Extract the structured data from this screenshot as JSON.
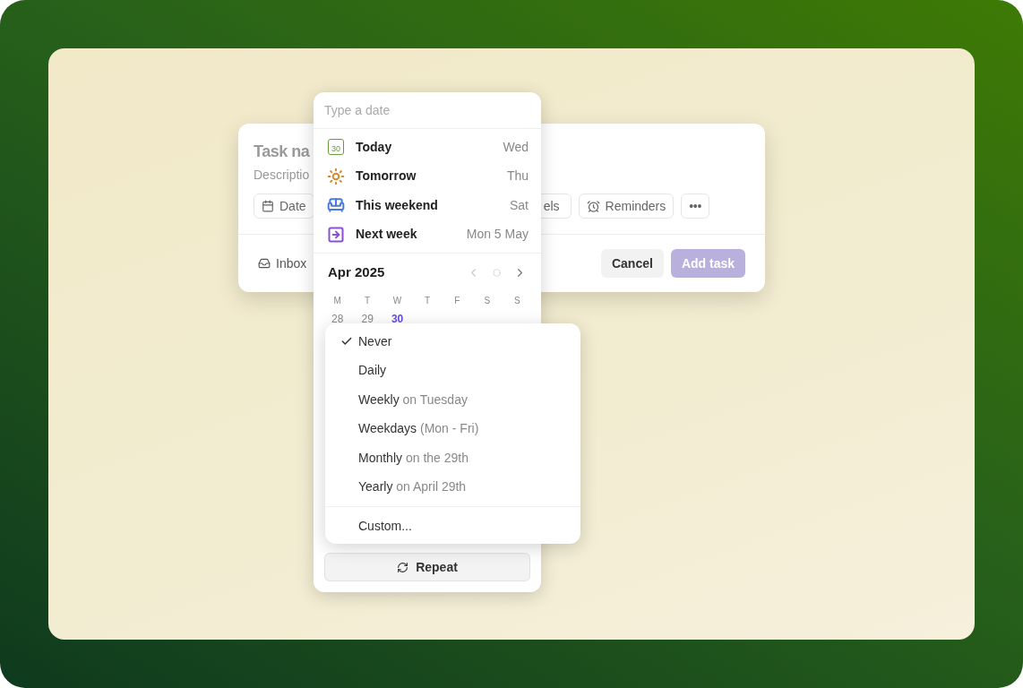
{
  "task_card": {
    "title": "Task na",
    "description": "Descriptio",
    "chips": [
      {
        "kind": "date",
        "label": "Date"
      },
      {
        "kind": "labels",
        "label": "els"
      },
      {
        "kind": "reminders",
        "label": "Reminders"
      },
      {
        "kind": "more",
        "label": "•••"
      }
    ],
    "project": "Inbox",
    "buttons": [
      {
        "kind": "cancel",
        "label": "Cancel",
        "disabled": false
      },
      {
        "kind": "submit",
        "label": "Add task",
        "disabled": true
      }
    ]
  },
  "date_picker": {
    "placeholder": "Type a date",
    "suggestions": [
      {
        "kind": "today",
        "label": "Today",
        "day": "Wed",
        "color": "#6a9a3c",
        "badge": "30"
      },
      {
        "kind": "tomorrow",
        "label": "Tomorrow",
        "day": "Thu",
        "color": "#d68a2a"
      },
      {
        "kind": "weekend",
        "label": "This weekend",
        "day": "Sat",
        "color": "#4a7bd9"
      },
      {
        "kind": "next_week",
        "label": "Next week",
        "day": "Mon 5 May",
        "color": "#8a4fd6"
      }
    ],
    "month": "Apr 2025",
    "weekdays": [
      "M",
      "T",
      "W",
      "T",
      "F",
      "S",
      "S"
    ],
    "days": [
      {
        "label": "28",
        "selected": false
      },
      {
        "label": "29",
        "selected": false
      },
      {
        "label": "30",
        "selected": true
      }
    ],
    "repeat_button": "Repeat"
  },
  "repeat_menu": {
    "options": [
      {
        "label": "Never",
        "selected": true
      },
      {
        "label": "Daily",
        "selected": false
      },
      {
        "label": "Weekly",
        "detail": "on Tuesday",
        "selected": false
      },
      {
        "label": "Weekdays",
        "detail": "(Mon - Fri)",
        "selected": false
      },
      {
        "label": "Monthly",
        "detail": "on the 29th",
        "selected": false
      },
      {
        "label": "Yearly",
        "detail": "on April 29th",
        "selected": false
      }
    ],
    "custom": "Custom..."
  }
}
